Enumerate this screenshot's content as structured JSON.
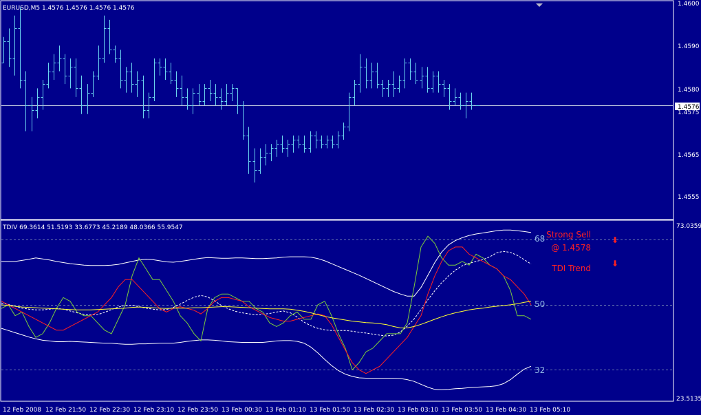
{
  "price_panel": {
    "header": "EURUSD,M5  1.4576 1.4576 1.4576 1.4576",
    "current_price_label": "1.4576",
    "axis_labels": [
      "1.4600",
      "1.4590",
      "1.4580",
      "1.4575",
      "1.4565",
      "1.4555"
    ]
  },
  "indicator_panel": {
    "header": "TDIV 69.3614 51.5193 33.6773 45.2189 48.0366 55.9547",
    "axis_max_label": "73.0359",
    "axis_min_label": "23.5135",
    "level_high": "68",
    "level_mid": "50",
    "level_low": "32",
    "signal_line1": "Strong Sell",
    "signal_line2": "@ 1.4578",
    "trend_label": "TDI Trend",
    "signal_arrow": "⬇",
    "trend_arrow": "⬇"
  },
  "time_axis": [
    "12 Feb 2008",
    "12 Feb 21:50",
    "12 Feb 22:30",
    "12 Feb 23:10",
    "12 Feb 23:50",
    "13 Feb 00:30",
    "13 Feb 01:10",
    "13 Feb 01:50",
    "13 Feb 02:30",
    "13 Feb 03:10",
    "13 Feb 03:50",
    "13 Feb 04:30",
    "13 Feb 05:10"
  ],
  "colors": {
    "background": "#00008B",
    "bars": "#69D2F0",
    "bands": "#FFFFFF",
    "rsi_price": "#7CCD3C",
    "signal": "#FF2020",
    "market_base": "#FFFF33",
    "level_text": "#8FB5E6",
    "signal_text": "#FF2020",
    "grid": "#6B7AAE"
  },
  "chart_data": [
    {
      "type": "ohlc",
      "symbol": "EURUSD",
      "timeframe": "M5",
      "ylim": [
        1.455,
        1.46
      ],
      "current_price": 1.4576,
      "bars": [
        [
          1.4586,
          1.4592,
          1.4586,
          1.4591
        ],
        [
          1.4591,
          1.4594,
          1.4585,
          1.4587
        ],
        [
          1.4587,
          1.4597,
          1.4583,
          1.4594
        ],
        [
          1.4594,
          1.4599,
          1.458,
          1.4582
        ],
        [
          1.4582,
          1.4584,
          1.457,
          1.4576
        ],
        [
          1.4576,
          1.4578,
          1.457,
          1.4575
        ],
        [
          1.4575,
          1.458,
          1.4573,
          1.4578
        ],
        [
          1.4578,
          1.4582,
          1.4575,
          1.4581
        ],
        [
          1.4581,
          1.4586,
          1.458,
          1.4584
        ],
        [
          1.4584,
          1.4588,
          1.4582,
          1.4586
        ],
        [
          1.4586,
          1.459,
          1.4584,
          1.4587
        ],
        [
          1.4587,
          1.4588,
          1.4581,
          1.4583
        ],
        [
          1.4583,
          1.4587,
          1.458,
          1.4585
        ],
        [
          1.4585,
          1.4587,
          1.4578,
          1.458
        ],
        [
          1.458,
          1.4583,
          1.4574,
          1.4576
        ],
        [
          1.4576,
          1.4581,
          1.4574,
          1.4579
        ],
        [
          1.4579,
          1.4584,
          1.4578,
          1.4583
        ],
        [
          1.4583,
          1.459,
          1.4582,
          1.4587
        ],
        [
          1.4587,
          1.4597,
          1.4586,
          1.4594
        ],
        [
          1.4594,
          1.4596,
          1.4588,
          1.4589
        ],
        [
          1.4589,
          1.459,
          1.4586,
          1.4587
        ],
        [
          1.4587,
          1.4589,
          1.458,
          1.4582
        ],
        [
          1.4582,
          1.4585,
          1.4579,
          1.4584
        ],
        [
          1.4584,
          1.4586,
          1.4579,
          1.4581
        ],
        [
          1.4581,
          1.4584,
          1.4578,
          1.4582
        ],
        [
          1.4582,
          1.4583,
          1.4573,
          1.4575
        ],
        [
          1.4575,
          1.4579,
          1.4573,
          1.4578
        ],
        [
          1.4578,
          1.4587,
          1.4577,
          1.4586
        ],
        [
          1.4586,
          1.4587,
          1.4583,
          1.4585
        ],
        [
          1.4585,
          1.4587,
          1.4582,
          1.4584
        ],
        [
          1.4584,
          1.4586,
          1.4581,
          1.4582
        ],
        [
          1.4582,
          1.4584,
          1.4578,
          1.458
        ],
        [
          1.458,
          1.4583,
          1.4576,
          1.4578
        ],
        [
          1.4578,
          1.458,
          1.4575,
          1.4576
        ],
        [
          1.4576,
          1.458,
          1.4574,
          1.4579
        ],
        [
          1.4579,
          1.4581,
          1.4576,
          1.4577
        ],
        [
          1.4577,
          1.4581,
          1.4576,
          1.458
        ],
        [
          1.458,
          1.4582,
          1.4577,
          1.4579
        ],
        [
          1.4579,
          1.4581,
          1.4576,
          1.4578
        ],
        [
          1.4578,
          1.458,
          1.4575,
          1.4577
        ],
        [
          1.4577,
          1.4581,
          1.4576,
          1.4579
        ],
        [
          1.4579,
          1.4581,
          1.4577,
          1.458
        ],
        [
          1.458,
          1.458,
          1.4574,
          1.4576
        ],
        [
          1.4576,
          1.4577,
          1.4568,
          1.4569
        ],
        [
          1.4569,
          1.4571,
          1.456,
          1.4563
        ],
        [
          1.4563,
          1.4566,
          1.4558,
          1.4561
        ],
        [
          1.4561,
          1.4566,
          1.456,
          1.4564
        ],
        [
          1.4564,
          1.4567,
          1.4562,
          1.4565
        ],
        [
          1.4565,
          1.4567,
          1.4563,
          1.4566
        ],
        [
          1.4566,
          1.4568,
          1.4564,
          1.4567
        ],
        [
          1.4567,
          1.4569,
          1.4565,
          1.4566
        ],
        [
          1.4566,
          1.4568,
          1.4564,
          1.4567
        ],
        [
          1.4567,
          1.4569,
          1.4565,
          1.4568
        ],
        [
          1.4568,
          1.4569,
          1.4566,
          1.4567
        ],
        [
          1.4567,
          1.4569,
          1.4565,
          1.4566
        ],
        [
          1.4566,
          1.457,
          1.4565,
          1.4569
        ],
        [
          1.4569,
          1.457,
          1.4566,
          1.4568
        ],
        [
          1.4568,
          1.4569,
          1.4566,
          1.4567
        ],
        [
          1.4567,
          1.4569,
          1.4566,
          1.4568
        ],
        [
          1.4568,
          1.4569,
          1.4566,
          1.4567
        ],
        [
          1.4567,
          1.457,
          1.4566,
          1.4569
        ],
        [
          1.4569,
          1.4572,
          1.4568,
          1.4571
        ],
        [
          1.4571,
          1.4579,
          1.457,
          1.4578
        ],
        [
          1.4578,
          1.4582,
          1.4576,
          1.4581
        ],
        [
          1.4581,
          1.4588,
          1.4579,
          1.4585
        ],
        [
          1.4585,
          1.4587,
          1.458,
          1.4582
        ],
        [
          1.4582,
          1.4586,
          1.458,
          1.4584
        ],
        [
          1.4584,
          1.4586,
          1.458,
          1.4581
        ],
        [
          1.4581,
          1.4582,
          1.4578,
          1.458
        ],
        [
          1.458,
          1.4582,
          1.4578,
          1.4581
        ],
        [
          1.4581,
          1.4584,
          1.4578,
          1.458
        ],
        [
          1.458,
          1.4583,
          1.4579,
          1.4582
        ],
        [
          1.4582,
          1.4587,
          1.458,
          1.4586
        ],
        [
          1.4586,
          1.4587,
          1.4582,
          1.4584
        ],
        [
          1.4584,
          1.4586,
          1.4581,
          1.4582
        ],
        [
          1.4582,
          1.4585,
          1.458,
          1.4583
        ],
        [
          1.4583,
          1.4585,
          1.4579,
          1.458
        ],
        [
          1.458,
          1.4584,
          1.4579,
          1.4583
        ],
        [
          1.4583,
          1.4584,
          1.4579,
          1.4581
        ],
        [
          1.4581,
          1.4582,
          1.4578,
          1.458
        ],
        [
          1.458,
          1.4581,
          1.4575,
          1.4577
        ],
        [
          1.4577,
          1.458,
          1.4576,
          1.4578
        ],
        [
          1.4578,
          1.4579,
          1.4575,
          1.4576
        ],
        [
          1.4576,
          1.4579,
          1.4573,
          1.4577
        ],
        [
          1.4577,
          1.4579,
          1.4575,
          1.4576
        ],
        [
          1.4576,
          1.4576,
          1.4576,
          1.4576
        ]
      ]
    },
    {
      "type": "line",
      "name": "TDIV",
      "ylim": [
        23.5135,
        73.0359
      ],
      "levels": [
        68,
        50,
        32
      ],
      "series": [
        {
          "role": "upper_band",
          "style": "solid",
          "color": "#FFFFFF",
          "values": [
            62,
            62,
            62,
            62.3,
            62.6,
            63,
            62.7,
            62.4,
            62,
            61.7,
            61.4,
            61.2,
            61,
            60.9,
            60.9,
            60.9,
            61,
            61.2,
            61.6,
            62,
            62.4,
            62.6,
            62.5,
            62.2,
            61.9,
            61.8,
            62,
            62.3,
            62.6,
            62.9,
            63.1,
            63,
            62.9,
            62.9,
            63,
            63,
            62.9,
            62.8,
            62.8,
            62.9,
            63,
            63.2,
            63.3,
            63.3,
            63.3,
            63.2,
            62.8,
            62.2,
            61.4,
            60.6,
            59.8,
            59,
            58.2,
            57.3,
            56.4,
            55.5,
            54.6,
            53.7,
            53,
            52.4,
            52.4,
            54.8,
            58.2,
            61.7,
            64.6,
            66.6,
            67.8,
            68.6,
            69.2,
            69.6,
            69.9,
            70.2,
            70.5,
            70.7,
            70.7,
            70.5,
            70.3,
            70
          ]
        },
        {
          "role": "lower_band",
          "style": "solid",
          "color": "#FFFFFF",
          "values": [
            43.5,
            42.9,
            42.3,
            41.7,
            41.1,
            40.6,
            40.2,
            40,
            39.8,
            39.8,
            39.9,
            39.8,
            39.7,
            39.6,
            39.5,
            39.4,
            39.4,
            39.2,
            39.1,
            39.1,
            39.2,
            39.2,
            39.3,
            39.4,
            39.4,
            39.4,
            39.6,
            39.9,
            40.1,
            40.3,
            40.3,
            40.2,
            40,
            39.8,
            39.7,
            39.6,
            39.6,
            39.6,
            39.6,
            39.8,
            40,
            40.1,
            40.1,
            39.9,
            39.4,
            38.3,
            36.7,
            34.9,
            33.2,
            31.8,
            30.8,
            30.2,
            29.8,
            29.7,
            29.7,
            29.7,
            29.7,
            29.7,
            29.6,
            29.3,
            28.8,
            28,
            27.2,
            26.6,
            26.5,
            26.6,
            26.8,
            26.9,
            27.1,
            27.2,
            27.3,
            27.4,
            27.6,
            28.2,
            29.3,
            30.8,
            32.2,
            33
          ]
        },
        {
          "role": "mid_band",
          "style": "dashed",
          "color": "#FFFFFF",
          "values": [
            50.5,
            50.1,
            49.6,
            49.1,
            48.8,
            48.6,
            48.6,
            48.8,
            49,
            48.8,
            48.3,
            47.8,
            47.4,
            47.2,
            47.3,
            47.9,
            48.7,
            49.4,
            49.8,
            49.9,
            49.5,
            49.1,
            48.8,
            48.6,
            48.7,
            49.3,
            50.2,
            51.2,
            52.1,
            52.6,
            52.2,
            51.1,
            49.8,
            48.9,
            48.2,
            47.8,
            47.5,
            47.3,
            47.4,
            47.6,
            48,
            48.3,
            47.8,
            46.6,
            45.2,
            44.2,
            43.5,
            43.1,
            42.9,
            42.9,
            42.9,
            42.7,
            42.4,
            42.2,
            41.9,
            41.6,
            41.4,
            41.6,
            42.5,
            44.1,
            46.1,
            48.7,
            51.4,
            53.9,
            56.1,
            58,
            59.6,
            60.8,
            61.5,
            62,
            62.5,
            63.3,
            64.4,
            64.8,
            64.5,
            63.7,
            62.5,
            61.3
          ]
        },
        {
          "role": "rsi_price",
          "style": "solid",
          "color": "#7CCD3C",
          "values": [
            49,
            50,
            47,
            48,
            44,
            41,
            42,
            45,
            49,
            52,
            51,
            48,
            47,
            47,
            45,
            43,
            42,
            46,
            50,
            58,
            63,
            60,
            57,
            57,
            54,
            51,
            47,
            45,
            42,
            40,
            49,
            52,
            53,
            53,
            52,
            51,
            51,
            49,
            48,
            45,
            44,
            45,
            47,
            48,
            46,
            46,
            50,
            51,
            47,
            42,
            38,
            32,
            34,
            37,
            38,
            40,
            42,
            42,
            42,
            45,
            55,
            66,
            69,
            67,
            63,
            61,
            61,
            62,
            61,
            64,
            63,
            61,
            60,
            58,
            54,
            47,
            47,
            46
          ]
        },
        {
          "role": "signal",
          "style": "solid",
          "color": "#FF2020",
          "values": [
            51,
            50,
            49,
            48,
            47,
            46,
            45,
            44,
            43,
            43,
            44,
            45,
            46,
            47,
            48,
            50,
            52,
            55,
            57,
            57,
            55,
            53,
            51,
            49,
            48,
            49,
            49.5,
            49,
            48.5,
            47.5,
            49,
            51,
            52,
            52,
            51.5,
            51,
            49.5,
            48.5,
            47.5,
            46.5,
            46,
            45.5,
            45.5,
            46,
            46.5,
            47,
            47.5,
            47,
            44.5,
            41,
            37.5,
            34,
            32,
            31,
            32,
            33,
            35,
            37,
            39,
            41,
            44,
            47,
            53,
            58,
            62,
            65,
            66,
            66,
            64,
            63,
            62,
            61,
            60,
            58,
            57,
            55,
            53,
            50
          ]
        },
        {
          "role": "market_base",
          "style": "solid",
          "color": "#FFFF33",
          "values": [
            50,
            49.8,
            49.6,
            49.4,
            49.3,
            49.2,
            49.1,
            49,
            48.9,
            48.8,
            48.7,
            48.6,
            48.6,
            48.6,
            48.7,
            48.8,
            48.9,
            49,
            49.1,
            49.3,
            49.4,
            49.3,
            49.2,
            49.1,
            49,
            49.1,
            49.1,
            49.1,
            49.2,
            49.2,
            49.3,
            49.4,
            49.5,
            49.5,
            49.4,
            49.3,
            49.2,
            49.1,
            49,
            48.9,
            48.9,
            48.9,
            48.8,
            48.5,
            48.2,
            47.8,
            47.3,
            46.8,
            46.4,
            46.1,
            45.8,
            45.5,
            45.3,
            45.1,
            45,
            44.8,
            44.5,
            44,
            43.6,
            43.6,
            44,
            44.6,
            45.3,
            46,
            46.7,
            47.3,
            47.8,
            48.2,
            48.6,
            48.9,
            49.1,
            49.4,
            49.6,
            49.8,
            50,
            50.3,
            50.7,
            51
          ]
        }
      ]
    }
  ]
}
